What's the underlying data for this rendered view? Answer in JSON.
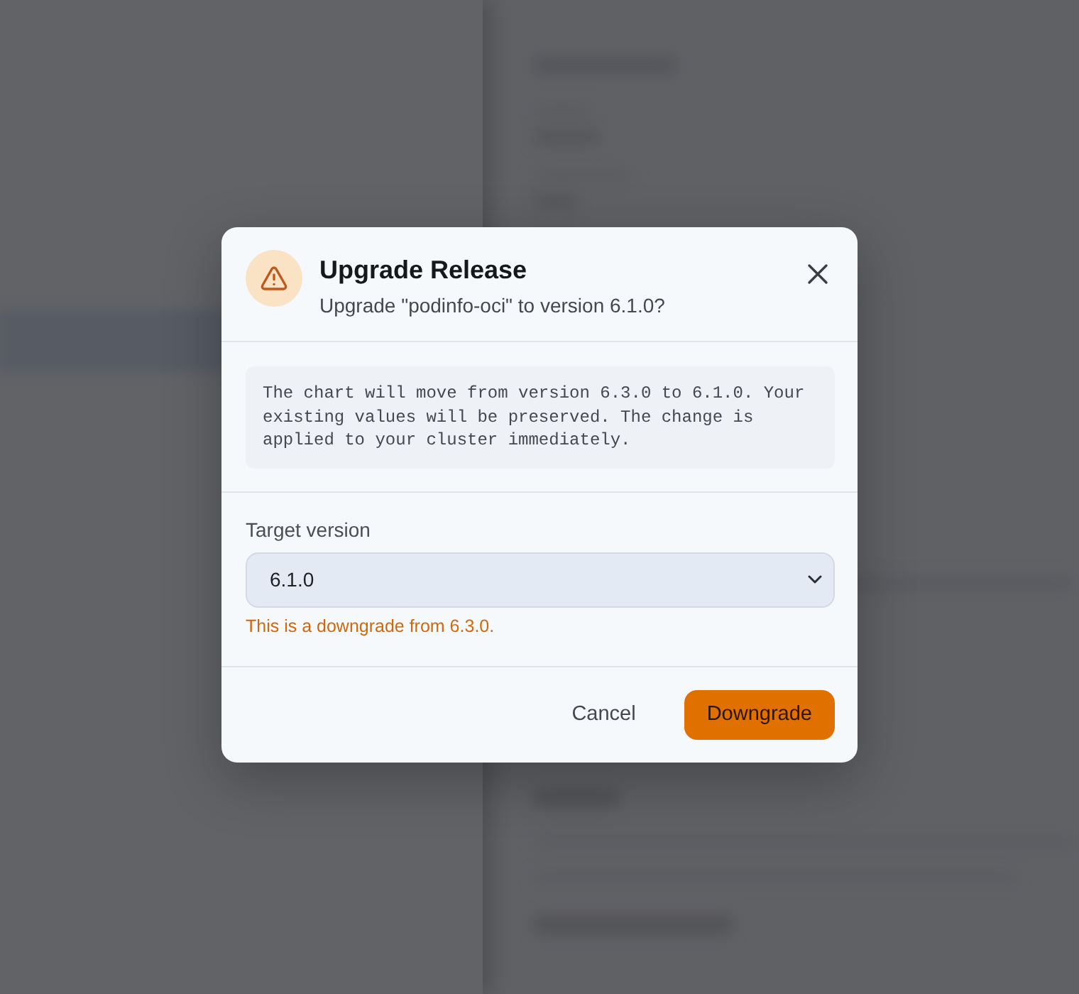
{
  "dialog": {
    "title": "Upgrade Release",
    "subtitle": "Upgrade \"podinfo-oci\" to version 6.1.0?",
    "notice": "The chart will move from version 6.3.0 to 6.1.0. Your existing values will be preserved. The change is applied to your cluster immediately.",
    "field": {
      "label": "Target version",
      "value": "6.1.0",
      "hint": "This is a downgrade from 6.3.0."
    },
    "buttons": [
      {
        "label": "Cancel",
        "kind": "secondary"
      },
      {
        "label": "Downgrade",
        "kind": "primary"
      }
    ]
  }
}
